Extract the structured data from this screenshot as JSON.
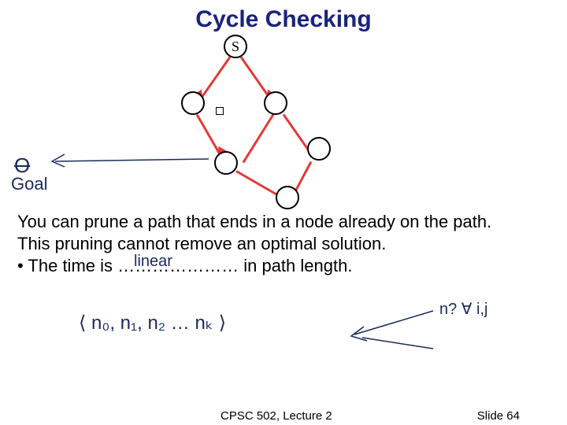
{
  "title": "Cycle Checking",
  "graph": {
    "start_label": "S"
  },
  "handwriting": {
    "scribble_a": "O",
    "scribble_b": "Goal",
    "annotation": "linear",
    "sequence": "⟨ n₀, n₁, n₂ … nₖ ⟩",
    "right_notes": "n? ∀ i,j"
  },
  "body": {
    "line1": "You can prune a path that ends in a node already on the path.",
    "line2": "This pruning cannot remove an optimal solution.",
    "line3_pre": "• The time is ………………… in path length."
  },
  "footer": {
    "course": "CPSC 502, Lecture 2",
    "slide": "Slide 64"
  }
}
